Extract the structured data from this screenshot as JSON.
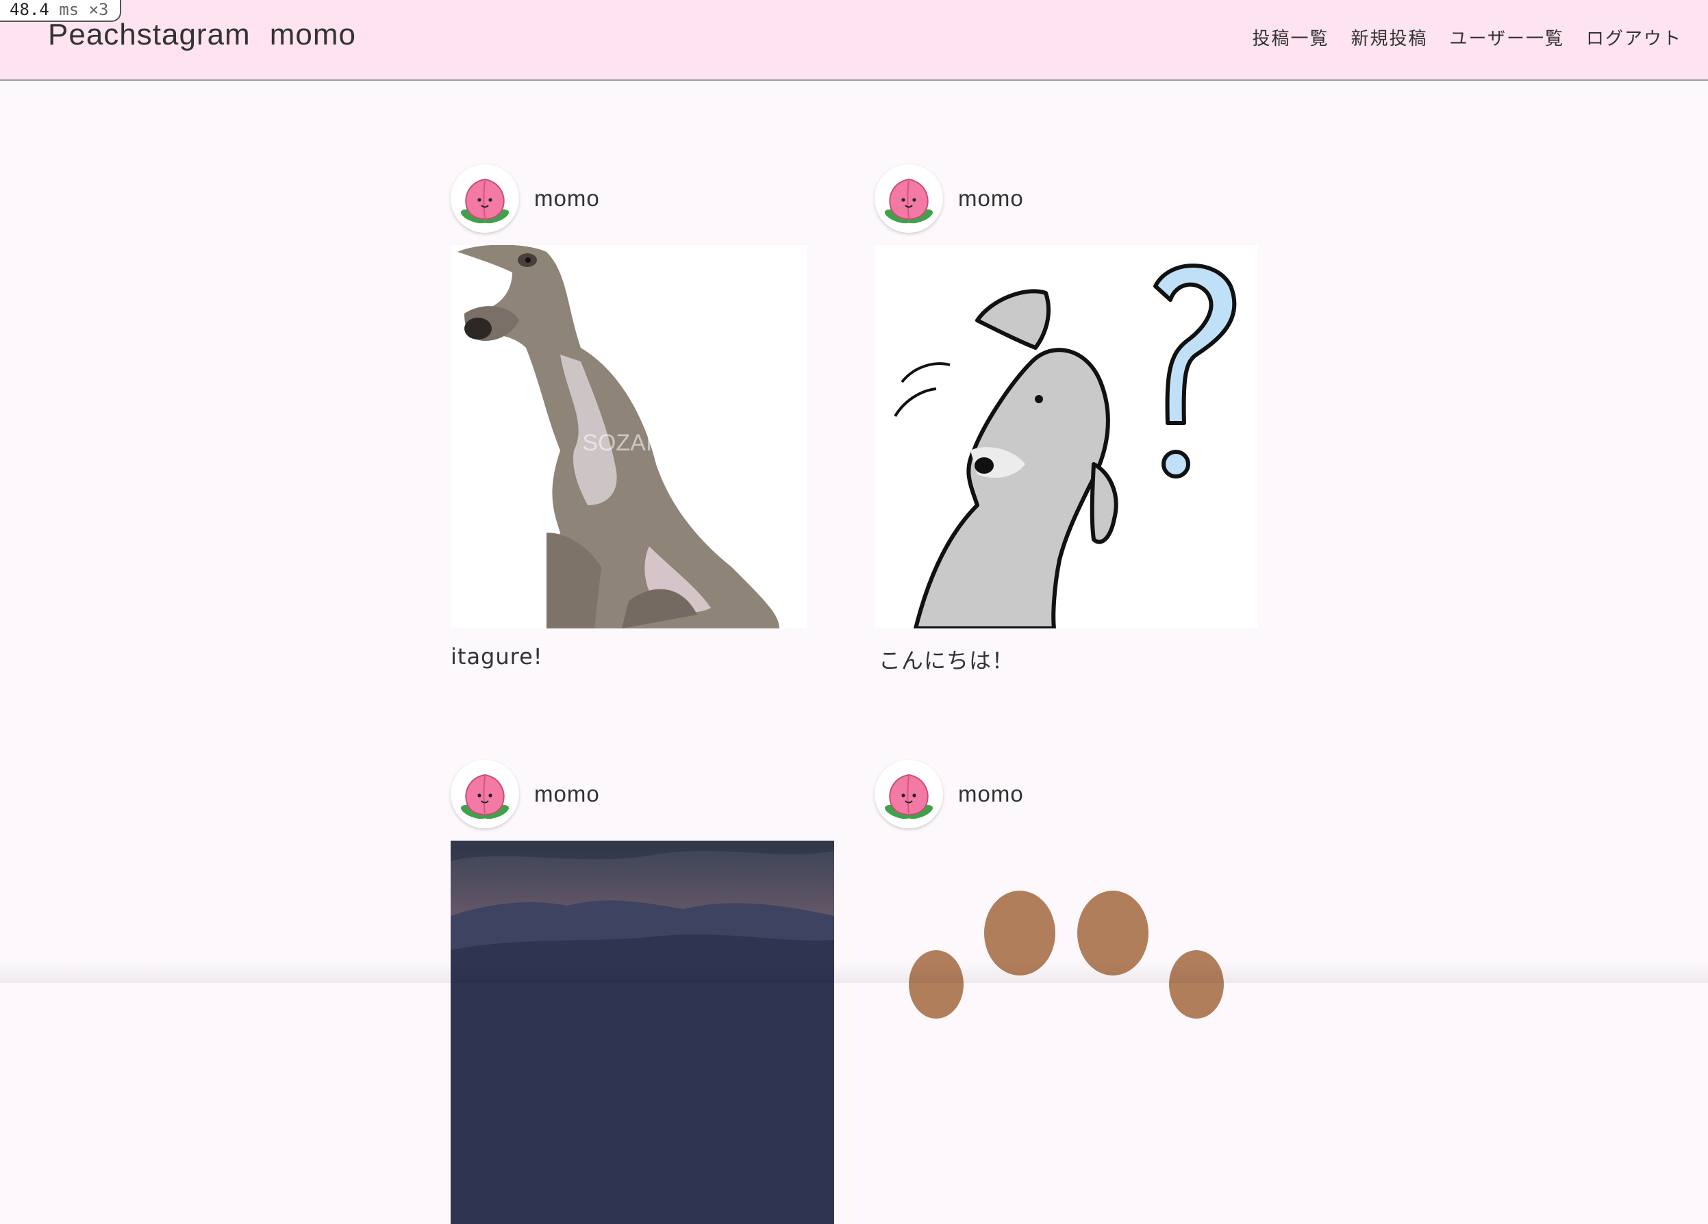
{
  "perf_badge": {
    "value": "48.4",
    "unit": "ms",
    "multiplier": "×3"
  },
  "header": {
    "brand": "Peachstagram",
    "current_user": "momo",
    "nav": [
      {
        "label": "投稿一覧"
      },
      {
        "label": "新規投稿"
      },
      {
        "label": "ユーザー一覧"
      },
      {
        "label": "ログアウト"
      }
    ]
  },
  "posts": [
    {
      "username": "momo",
      "caption": "itagure!",
      "image": "greyhound-watercolor"
    },
    {
      "username": "momo",
      "caption": "こんにちは！",
      "image": "dog-question-mark"
    },
    {
      "username": "momo",
      "caption": "",
      "image": "mountain-sunset"
    },
    {
      "username": "momo",
      "caption": "",
      "image": "paws"
    }
  ],
  "image_watermark": "SOZAI GOOD",
  "colors": {
    "header_bg": "#fee3f1",
    "page_bg": "#fcf8fc",
    "peach": "#f37aa4",
    "leaf": "#3fa24a"
  }
}
